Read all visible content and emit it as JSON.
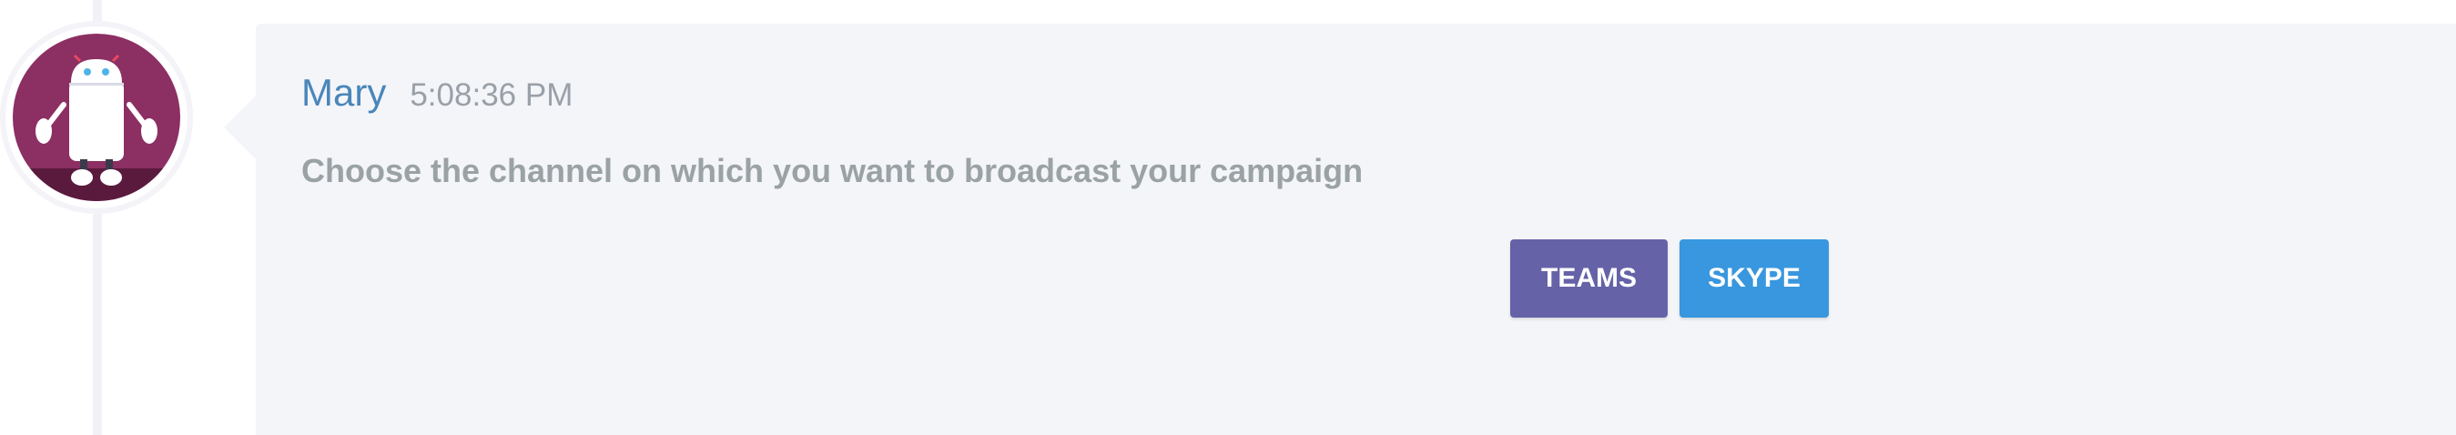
{
  "message": {
    "sender": "Mary",
    "time": "5:08:36 PM",
    "text": "Choose the channel on which you want to broadcast your campaign"
  },
  "actions": {
    "teams_label": "TEAMS",
    "skype_label": "SKYPE"
  },
  "icons": {
    "avatar": "robot-avatar-icon"
  },
  "colors": {
    "sender_name": "#4a86b9",
    "teams_button": "#6562a8",
    "skype_button": "#3897de",
    "avatar_background": "#8c2f63",
    "bubble_background": "#f4f5f9"
  }
}
